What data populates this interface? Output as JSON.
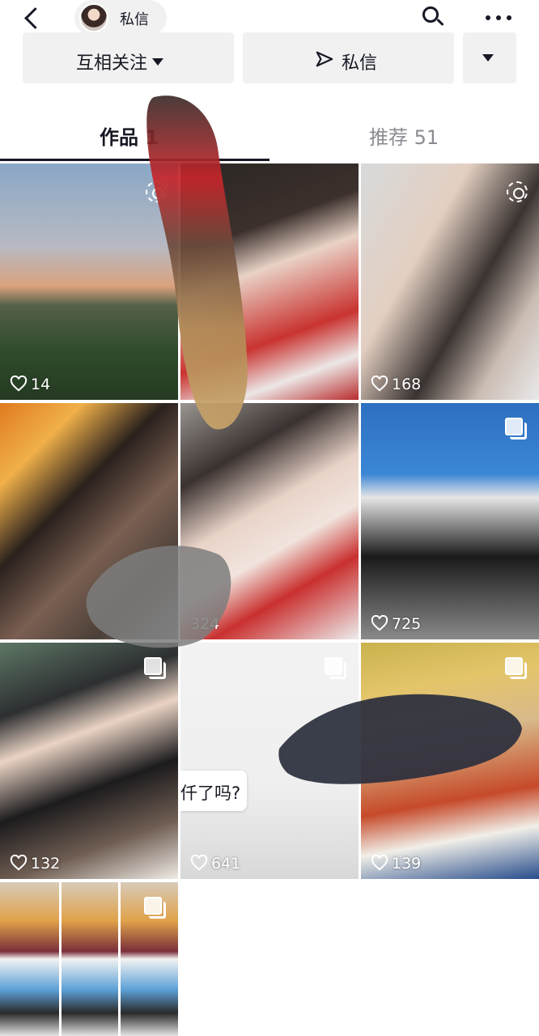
{
  "header": {
    "dm_label": "私信"
  },
  "actions": {
    "follow_label": "互相关注",
    "message_label": "私信"
  },
  "tabs": {
    "works_label": "作品 1",
    "recommend_label": "推荐 51"
  },
  "posts": [
    {
      "likes": "14",
      "badge": "live-icon"
    },
    {
      "likes": "",
      "badge": ""
    },
    {
      "likes": "168",
      "badge": "live-icon"
    },
    {
      "likes": "",
      "badge": ""
    },
    {
      "likes": "324",
      "badge": ""
    },
    {
      "likes": "725",
      "badge": "multi-image-icon"
    },
    {
      "likes": "132",
      "badge": "multi-image-icon"
    },
    {
      "likes": "641",
      "badge": "multi-image-icon",
      "caption": "仟了吗?"
    },
    {
      "likes": "139",
      "badge": "multi-image-icon"
    },
    {
      "likes": "",
      "badge": "multi-image-icon"
    }
  ],
  "colors": {
    "text": "#161823",
    "muted": "#8a8b91",
    "button_bg": "#f1f1f2"
  }
}
